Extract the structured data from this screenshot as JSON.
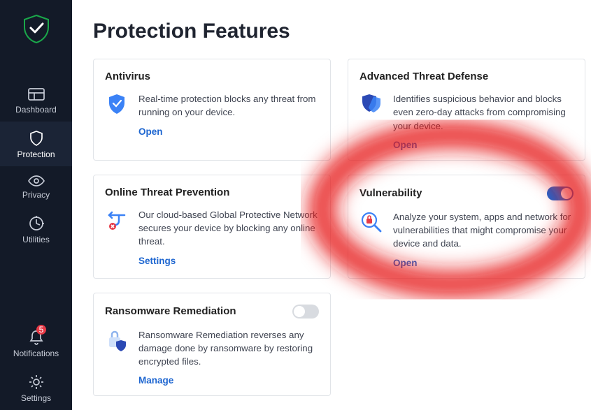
{
  "page_title": "Protection Features",
  "sidebar": {
    "items": [
      {
        "label": "Dashboard"
      },
      {
        "label": "Protection"
      },
      {
        "label": "Privacy"
      },
      {
        "label": "Utilities"
      }
    ],
    "bottom": [
      {
        "label": "Notifications",
        "badge": "5"
      },
      {
        "label": "Settings"
      }
    ]
  },
  "cards": [
    {
      "title": "Antivirus",
      "desc": "Real-time protection blocks any threat from running on your device.",
      "action": "Open"
    },
    {
      "title": "Advanced Threat Defense",
      "desc": "Identifies suspicious behavior and blocks even zero-day attacks from compromising your device.",
      "action": "Open"
    },
    {
      "title": "Online Threat Prevention",
      "desc": "Our cloud-based Global Protective Network secures your device by blocking any online threat.",
      "action": "Settings"
    },
    {
      "title": "Vulnerability",
      "desc": "Analyze your system, apps and network for vulnerabilities that might compromise your device and data.",
      "action": "Open"
    },
    {
      "title": "Ransomware Remediation",
      "desc": "Ransomware Remediation reverses any damage done by ransomware by restoring encrypted files.",
      "action": "Manage"
    }
  ]
}
